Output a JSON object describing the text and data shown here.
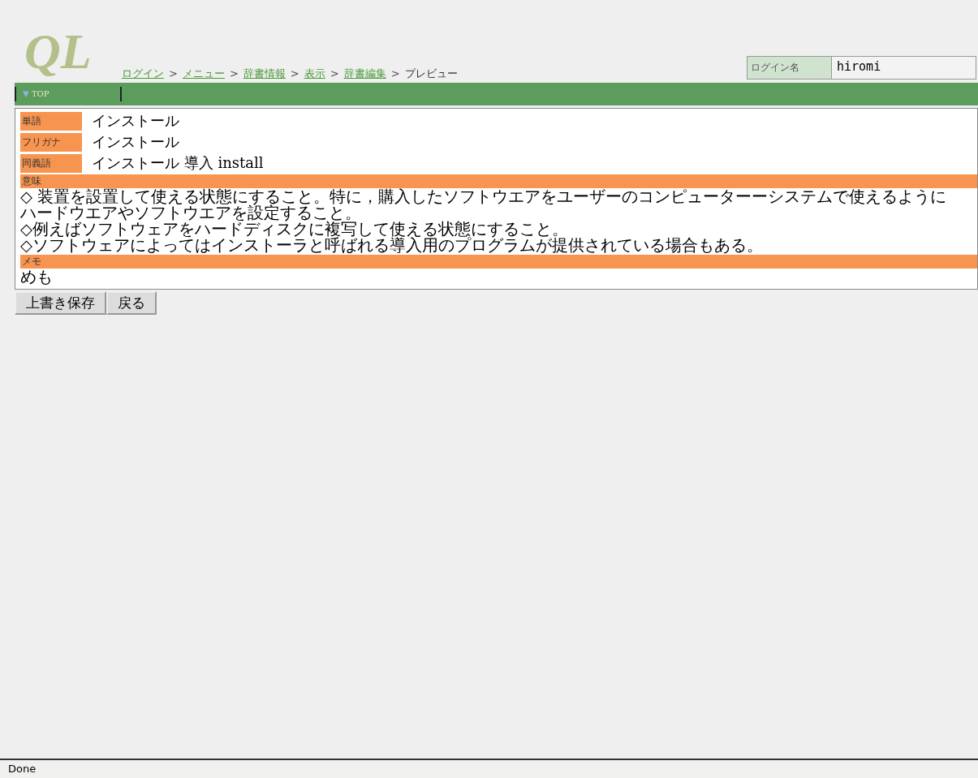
{
  "logo": {
    "text": "QL"
  },
  "breadcrumb": [
    {
      "label": "ログイン",
      "link": true
    },
    {
      "label": "メニュー",
      "link": true
    },
    {
      "label": "辞書情報",
      "link": true
    },
    {
      "label": "表示",
      "link": true
    },
    {
      "label": "辞書編集",
      "link": true
    },
    {
      "label": "プレビュー",
      "link": false
    }
  ],
  "breadcrumb_separator": ">",
  "login": {
    "label": "ログイン名",
    "value": "hiromi"
  },
  "nav_bar": {
    "arrow": "▼",
    "label": "TOP"
  },
  "fields": [
    {
      "label": "単語",
      "value": "インストール"
    },
    {
      "label": "フリガナ",
      "value": "インストール"
    },
    {
      "label": "同義語",
      "value": "インストール 導入 install"
    }
  ],
  "meaning": {
    "label": "意味",
    "lines": [
      "◇ 装置を設置して使える状態にすること。特に，購入したソフトウエアをユーザーのコンピューターーシステムで使えるように",
      "ハードウエアやソフトウエアを設定すること。",
      "◇例えばソフトウェアをハードディスクに複写して使える状態にすること。",
      "◇ソフトウェアによってはインストーラと呼ばれる導入用のプログラムが提供されている場合もある。"
    ]
  },
  "memo": {
    "label": "メモ",
    "value": "めも"
  },
  "buttons": [
    "上書き保存",
    "戻る"
  ],
  "status_bar": "Done"
}
